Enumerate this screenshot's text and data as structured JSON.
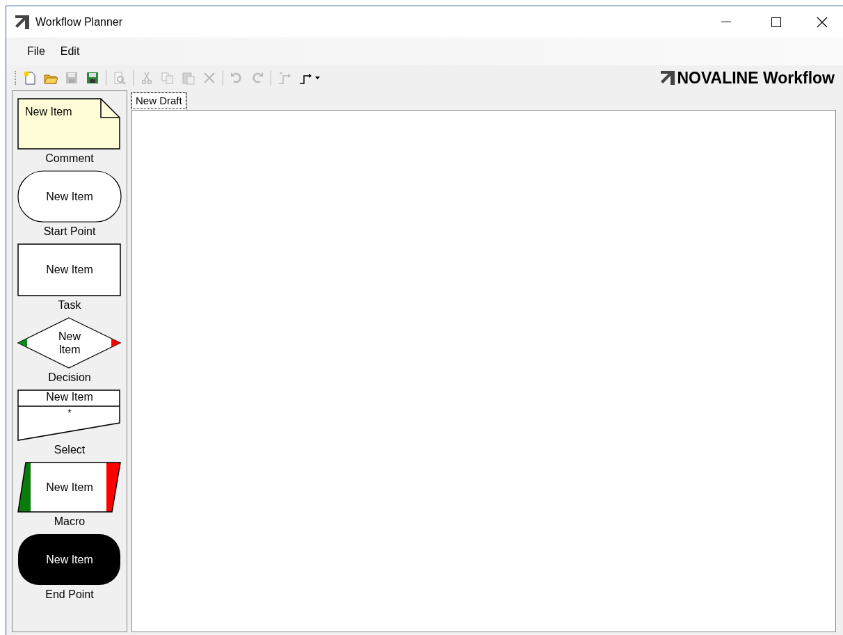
{
  "window": {
    "title": "Workflow Planner"
  },
  "menu": [
    "File",
    "Edit"
  ],
  "toolbar": [
    {
      "kind": "new",
      "disabled": false
    },
    {
      "kind": "open",
      "disabled": false
    },
    {
      "kind": "save",
      "disabled": true
    },
    {
      "kind": "save-all",
      "disabled": false
    },
    {
      "kind": "separator"
    },
    {
      "kind": "preview",
      "disabled": true
    },
    {
      "kind": "separator"
    },
    {
      "kind": "cut",
      "disabled": true
    },
    {
      "kind": "copy",
      "disabled": true
    },
    {
      "kind": "paste",
      "disabled": true
    },
    {
      "kind": "delete",
      "disabled": true
    },
    {
      "kind": "separator"
    },
    {
      "kind": "undo",
      "disabled": true
    },
    {
      "kind": "redo",
      "disabled": true
    },
    {
      "kind": "separator"
    },
    {
      "kind": "add-connector",
      "disabled": true
    },
    {
      "kind": "connector",
      "disabled": false
    }
  ],
  "brand": "NOVALINE Workflow",
  "palette": [
    {
      "kind": "comment",
      "text": "New Item",
      "label": "Comment"
    },
    {
      "kind": "start",
      "text": "New Item",
      "label": "Start Point"
    },
    {
      "kind": "task",
      "text": "New Item",
      "label": "Task"
    },
    {
      "kind": "decision",
      "text": "New\nItem",
      "label": "Decision"
    },
    {
      "kind": "select",
      "text": "New Item",
      "subtext": "*",
      "label": "Select"
    },
    {
      "kind": "macro",
      "text": "New Item",
      "label": "Macro"
    },
    {
      "kind": "end",
      "text": "New Item",
      "label": "End Point"
    }
  ],
  "tabs": [
    {
      "label": "New Draft",
      "selected": true
    }
  ]
}
